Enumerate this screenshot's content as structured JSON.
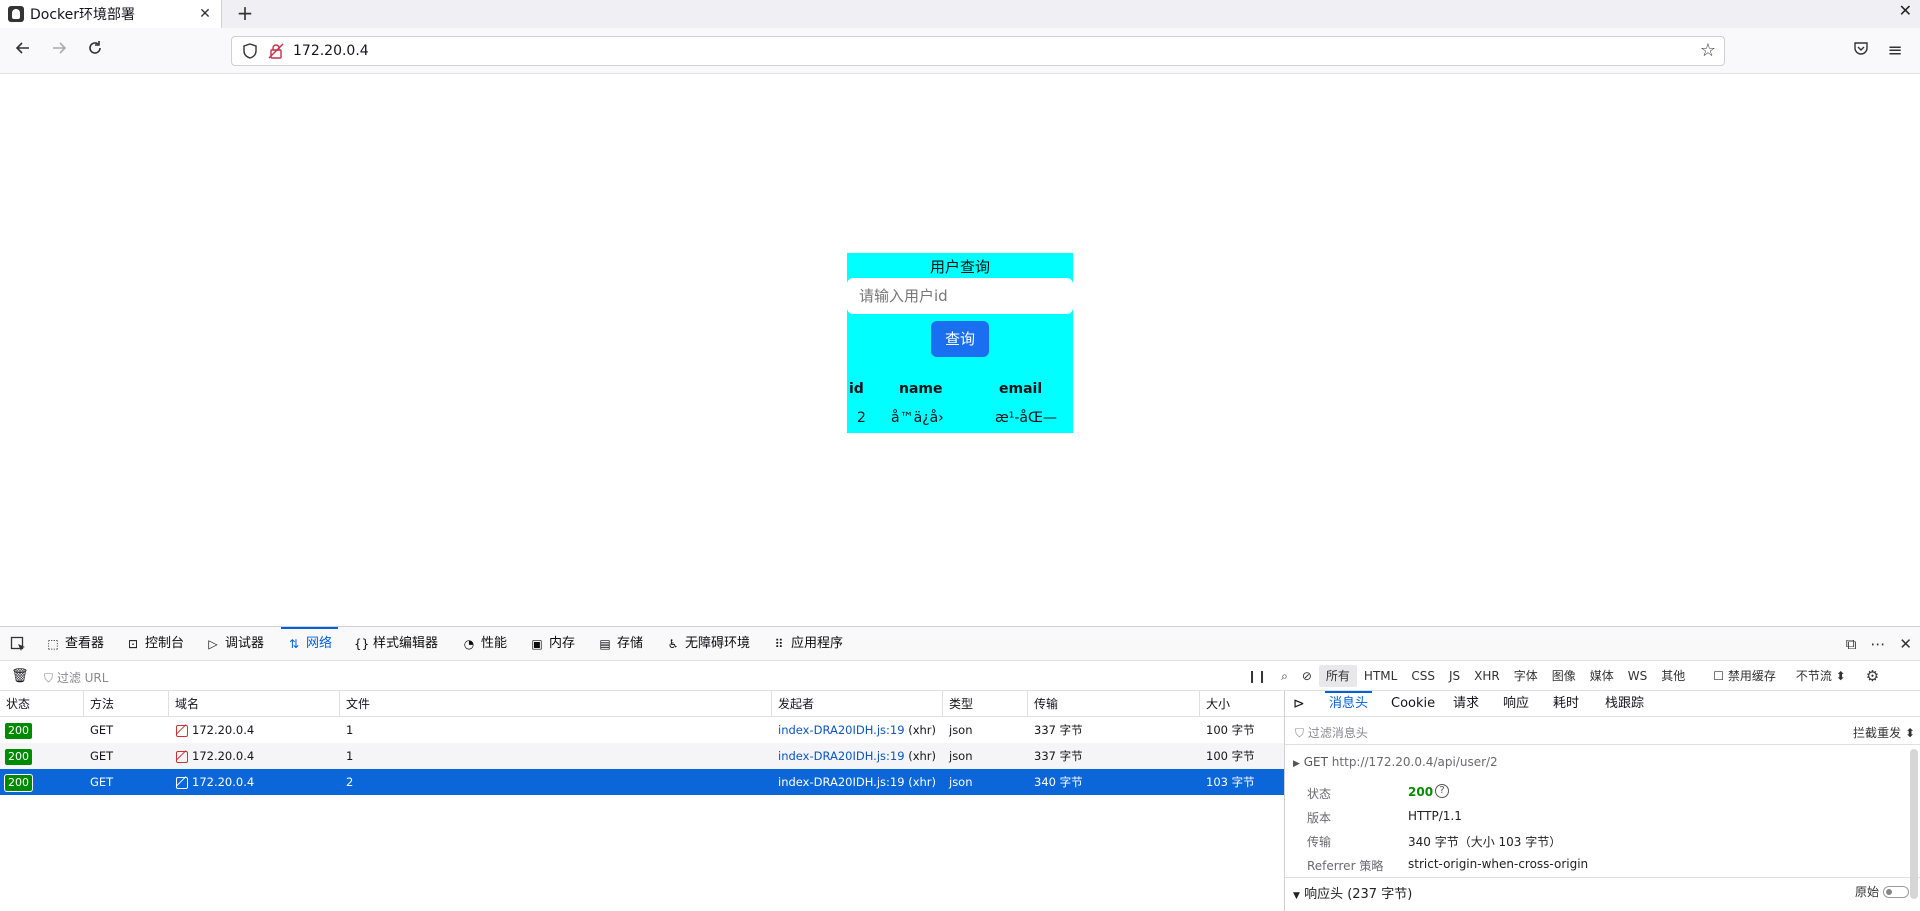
{
  "browser": {
    "tab_title": "Docker环境部署",
    "tab_close": "✕",
    "new_tab": "+",
    "window_close": "✕",
    "url": "172.20.0.4"
  },
  "page": {
    "card_title": "用户查询",
    "input_placeholder": "请输入用户id",
    "query_button": "查询",
    "table": {
      "headers": [
        "id",
        "name",
        "email"
      ],
      "row": [
        "2",
        "å™ä¿å›",
        "æ¹-åŒ—"
      ]
    }
  },
  "devtools": {
    "tabs": [
      "查看器",
      "控制台",
      "调试器",
      "网络",
      "样式编辑器",
      "性能",
      "内存",
      "存储",
      "无障碍环境",
      "应用程序"
    ],
    "selected_tab": "网络",
    "filter_placeholder": "过滤 URL",
    "type_filters": [
      "所有",
      "HTML",
      "CSS",
      "JS",
      "XHR",
      "字体",
      "图像",
      "媒体",
      "WS",
      "其他"
    ],
    "disable_cache_label": "禁用缓存",
    "throttle_label": "不节流 ⬍",
    "columns": [
      "状态",
      "方法",
      "域名",
      "文件",
      "发起者",
      "类型",
      "传输",
      "大小"
    ],
    "requests": [
      {
        "status": "200",
        "method": "GET",
        "domain": "172.20.0.4",
        "file": "1",
        "initiator": "index-DRA20IDH.js:19",
        "initiator_suffix": "(xhr)",
        "type": "json",
        "transfer": "337 字节",
        "size": "100 字节"
      },
      {
        "status": "200",
        "method": "GET",
        "domain": "172.20.0.4",
        "file": "1",
        "initiator": "index-DRA20IDH.js:19",
        "initiator_suffix": "(xhr)",
        "type": "json",
        "transfer": "337 字节",
        "size": "100 字节"
      },
      {
        "status": "200",
        "method": "GET",
        "domain": "172.20.0.4",
        "file": "2",
        "initiator": "index-DRA20IDH.js:19",
        "initiator_suffix": "(xhr)",
        "type": "json",
        "transfer": "340 字节",
        "size": "103 字节"
      }
    ],
    "side": {
      "tabs": [
        "消息头",
        "Cookie",
        "请求",
        "响应",
        "耗时",
        "栈跟踪"
      ],
      "filter_placeholder": "过滤消息头",
      "block_label": "拦截",
      "resend_label": "重发 ⬍",
      "request_line_method": "GET",
      "request_line_url": "http://172.20.0.4/api/user/2",
      "fields": [
        {
          "key": "状态",
          "value": "200"
        },
        {
          "key": "版本",
          "value": "HTTP/1.1"
        },
        {
          "key": "传输",
          "value": "340 字节（大小 103 字节）"
        },
        {
          "key": "Referrer 策略",
          "value": "strict-origin-when-cross-origin"
        }
      ],
      "response_headers_label": "响应头 (237 字节)",
      "raw_label": "原始"
    }
  }
}
